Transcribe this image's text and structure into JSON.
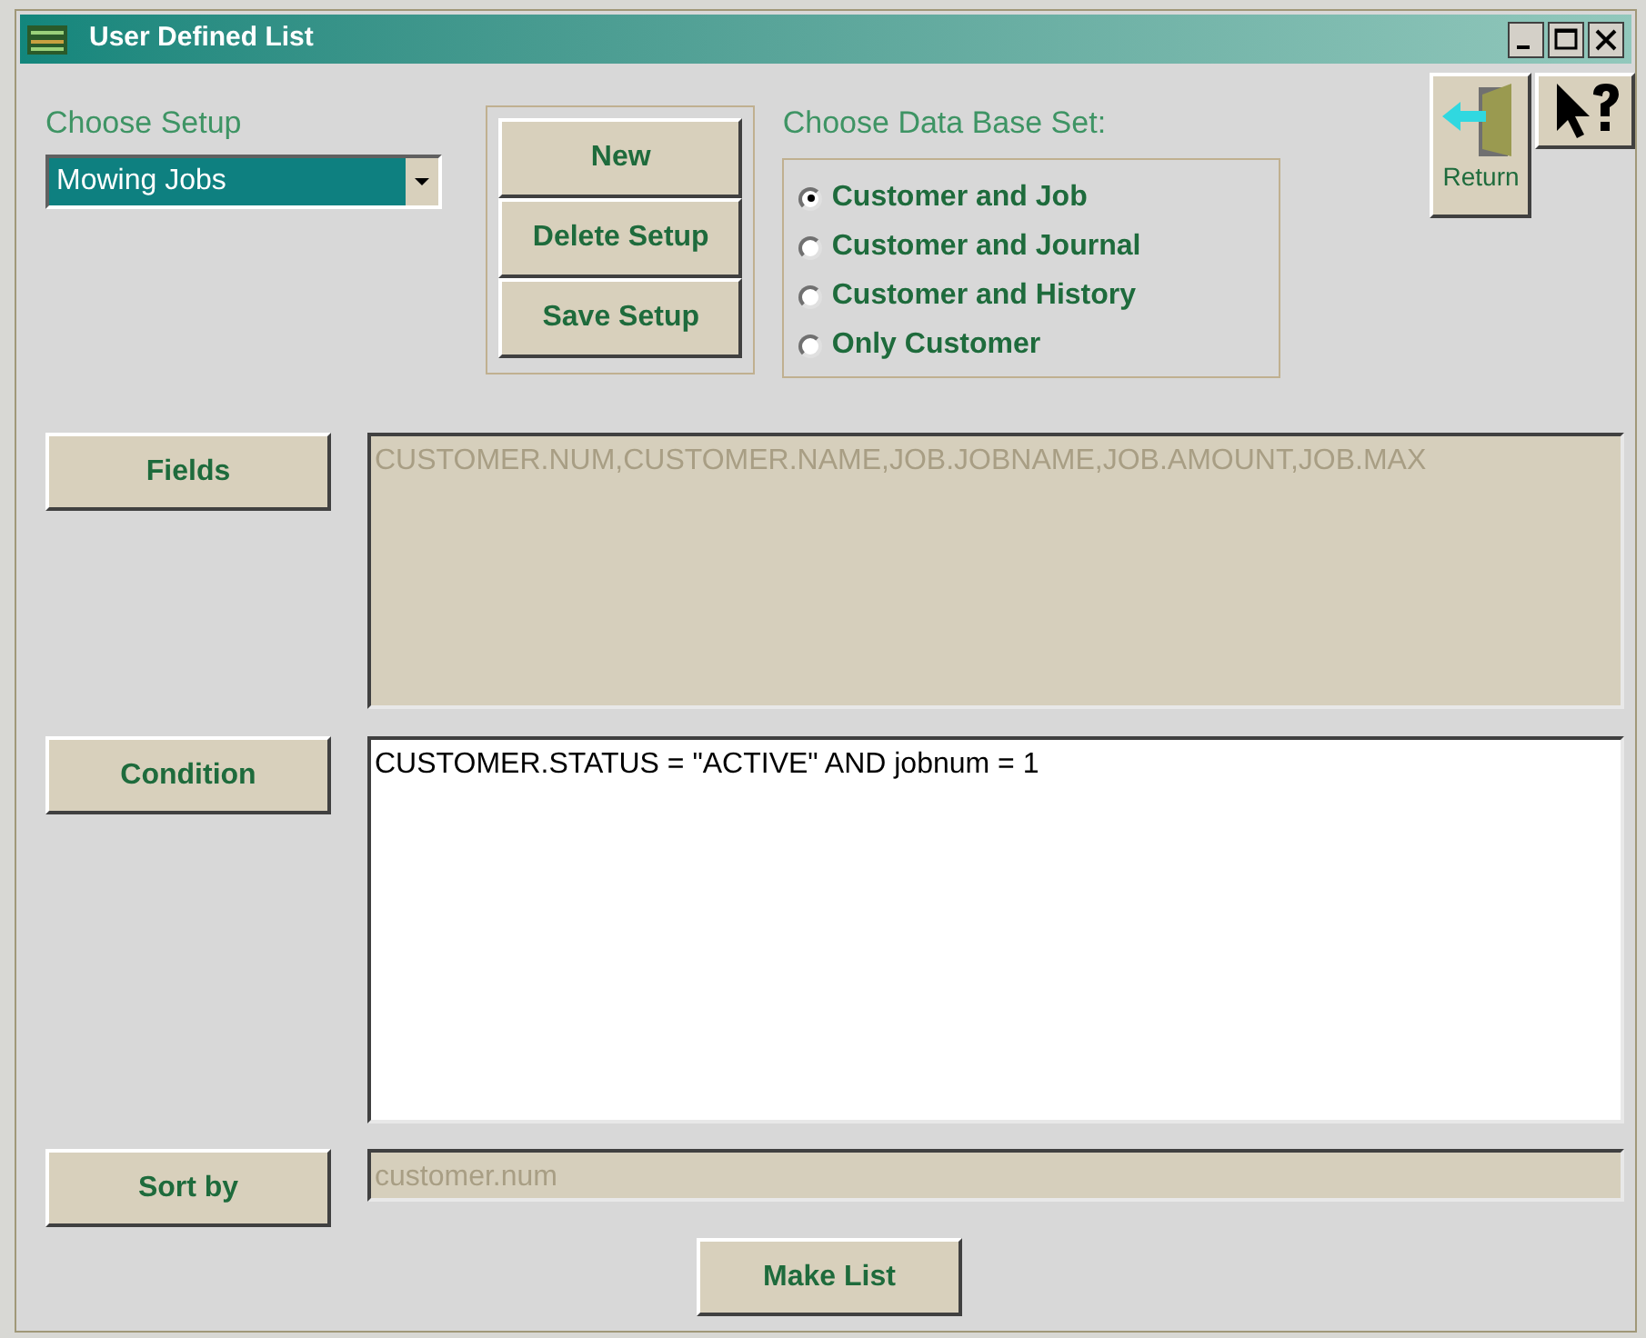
{
  "window": {
    "title": "User Defined List"
  },
  "setup": {
    "label": "Choose Setup",
    "value": "Mowing Jobs"
  },
  "setup_buttons": [
    "New",
    "Delete Setup",
    "Save Setup"
  ],
  "database_set": {
    "label": "Choose Data Base Set:",
    "options": [
      {
        "label": "Customer and Job",
        "selected": true
      },
      {
        "label": "Customer and Journal",
        "selected": false
      },
      {
        "label": "Customer and History",
        "selected": false
      },
      {
        "label": "Only Customer",
        "selected": false
      }
    ]
  },
  "return_button": {
    "label": "Return"
  },
  "fields": {
    "button": "Fields",
    "value": "CUSTOMER.NUM,CUSTOMER.NAME,JOB.JOBNAME,JOB.AMOUNT,JOB.MAX",
    "disabled": true
  },
  "condition": {
    "button": "Condition",
    "value": "CUSTOMER.STATUS = \"ACTIVE\" AND jobnum = 1",
    "disabled": false
  },
  "sort_by": {
    "button": "Sort by",
    "value": "customer.num",
    "disabled": true
  },
  "make_list_button": "Make List"
}
